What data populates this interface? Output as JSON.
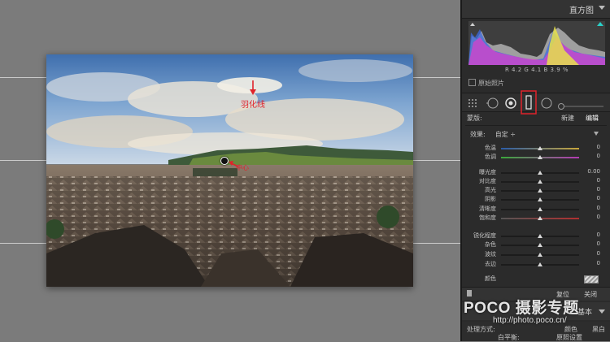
{
  "panel": {
    "title": "直方图",
    "readout": {
      "r_label": "R",
      "r": "4.2",
      "g_label": "G",
      "g": "4.1",
      "b_label": "B",
      "b": "3.9",
      "unit": "%"
    },
    "original_photo_label": "原始照片"
  },
  "mask": {
    "label": "蒙版:",
    "new_label": "新建",
    "edit_label": "编辑"
  },
  "effect": {
    "label": "效果:",
    "value": "自定 ÷"
  },
  "sliders": [
    {
      "label": "色温",
      "value": "0",
      "pos": 0.5
    },
    {
      "label": "色调",
      "value": "0",
      "pos": 0.5
    },
    {
      "label": "曝光度",
      "value": "0.00",
      "pos": 0.5
    },
    {
      "label": "对比度",
      "value": "0",
      "pos": 0.5
    },
    {
      "label": "高光",
      "value": "0",
      "pos": 0.5
    },
    {
      "label": "阴影",
      "value": "0",
      "pos": 0.5
    },
    {
      "label": "清晰度",
      "value": "0",
      "pos": 0.5
    },
    {
      "label": "饱和度",
      "value": "0",
      "pos": 0.5
    },
    {
      "label": "锐化程度",
      "value": "0",
      "pos": 0.5
    },
    {
      "label": "杂色",
      "value": "0",
      "pos": 0.5
    },
    {
      "label": "波纹",
      "value": "0",
      "pos": 0.5
    },
    {
      "label": "去边",
      "value": "0",
      "pos": 0.5
    }
  ],
  "color_label": "颜色",
  "buttons": {
    "reset": "复位",
    "close": "关闭"
  },
  "basic": {
    "title": "基本",
    "row1_left": "处理方式:",
    "row1_mid": "颜色",
    "row1_right": "黑白",
    "row2_left": "白平衡:",
    "row2_right": "原照设置"
  },
  "annotations": {
    "feather_line": "羽化线",
    "center": "中心"
  },
  "watermark": {
    "line1": "POCO 摄影专题",
    "line2": "http://photo.poco.cn/"
  },
  "colors": {
    "accent_red": "#e0232b",
    "panel_bg": "#2b2b2b",
    "canvas_bg": "#7b7b7b"
  }
}
